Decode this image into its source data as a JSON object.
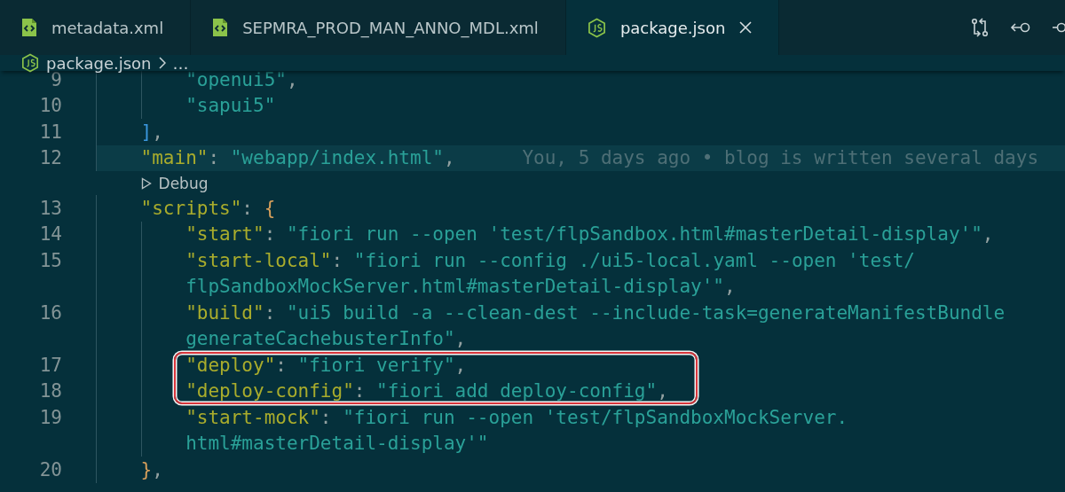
{
  "tabs": [
    {
      "label": "metadata.xml",
      "kind": "xml",
      "selected": false
    },
    {
      "label": "SEPMRA_PROD_MAN_ANNO_MDL.xml",
      "kind": "xml",
      "selected": false
    },
    {
      "label": "package.json",
      "kind": "json",
      "selected": true
    }
  ],
  "breadcrumb": {
    "file": "package.json",
    "more": "…"
  },
  "lines": [
    {
      "kind": "block",
      "children": [
        {
          "kind": "code",
          "number": "9",
          "current": false,
          "boxed": false,
          "tokens": [
            {
              "kind": "string",
              "text": "\"openui5\""
            },
            {
              "kind": "punct",
              "text": ","
            }
          ]
        },
        {
          "kind": "code",
          "number": "10",
          "current": false,
          "boxed": false,
          "tokens": [
            {
              "kind": "string",
              "text": "\"sapui5\""
            }
          ]
        }
      ]
    },
    {
      "kind": "code",
      "number": "11",
      "current": false,
      "boxed": false,
      "tokens": [
        {
          "kind": "bracket",
          "text": "]"
        },
        {
          "kind": "punct",
          "text": ","
        }
      ]
    },
    {
      "kind": "code",
      "number": "12",
      "current": true,
      "boxed": false,
      "blame": "You, 5 days ago • blog is written several days",
      "tokens": [
        {
          "kind": "key",
          "text": "\"main\""
        },
        {
          "kind": "punct",
          "text": ": "
        },
        {
          "kind": "string",
          "text": "\"webapp/index.html\""
        },
        {
          "kind": "punct",
          "text": ","
        }
      ]
    },
    {
      "kind": "codelens",
      "label": "Debug"
    },
    {
      "kind": "code",
      "number": "13",
      "current": false,
      "boxed": false,
      "tokens": [
        {
          "kind": "key",
          "text": "\"scripts\""
        },
        {
          "kind": "punct",
          "text": ": "
        },
        {
          "kind": "brace",
          "text": "{"
        }
      ]
    },
    {
      "kind": "block",
      "children": [
        {
          "kind": "code",
          "number": "14",
          "current": false,
          "boxed": false,
          "tokens": [
            {
              "kind": "key",
              "text": "\"start\""
            },
            {
              "kind": "punct",
              "text": ": "
            },
            {
              "kind": "string",
              "text": "\"fiori run --open 'test/flpSandbox.html#masterDetail-display'\""
            },
            {
              "kind": "punct",
              "text": ","
            }
          ]
        },
        {
          "kind": "code",
          "number": "15",
          "current": false,
          "boxed": false,
          "tokens": [
            {
              "kind": "key",
              "text": "\"start-local\""
            },
            {
              "kind": "punct",
              "text": ": "
            },
            {
              "kind": "string",
              "text": "\"fiori run --config ./ui5-local.yaml --open 'test/"
            }
          ]
        },
        {
          "kind": "code",
          "current": false,
          "boxed": false,
          "tokens": [
            {
              "kind": "string",
              "text": "flpSandboxMockServer.html#masterDetail-display'\""
            },
            {
              "kind": "punct",
              "text": ","
            }
          ]
        },
        {
          "kind": "code",
          "number": "16",
          "current": false,
          "boxed": false,
          "tokens": [
            {
              "kind": "key",
              "text": "\"build\""
            },
            {
              "kind": "punct",
              "text": ": "
            },
            {
              "kind": "string",
              "text": "\"ui5 build -a --clean-dest --include-task=generateManifestBundle"
            }
          ]
        },
        {
          "kind": "code",
          "current": false,
          "boxed": false,
          "tokens": [
            {
              "kind": "string",
              "text": "generateCachebusterInfo\""
            },
            {
              "kind": "punct",
              "text": ","
            }
          ]
        },
        {
          "kind": "code",
          "number": "17",
          "current": false,
          "boxed": true,
          "tokens": [
            {
              "kind": "key",
              "text": "\"deploy\""
            },
            {
              "kind": "punct",
              "text": ": "
            },
            {
              "kind": "string",
              "text": "\"fiori verify\""
            },
            {
              "kind": "punct",
              "text": ","
            }
          ]
        },
        {
          "kind": "code",
          "number": "18",
          "current": false,
          "boxed": true,
          "tokens": [
            {
              "kind": "key",
              "text": "\"deploy-config\""
            },
            {
              "kind": "punct",
              "text": ": "
            },
            {
              "kind": "string",
              "text": "\"fiori add deploy-config\""
            },
            {
              "kind": "punct",
              "text": ","
            }
          ]
        },
        {
          "kind": "code",
          "number": "19",
          "current": false,
          "boxed": false,
          "tokens": [
            {
              "kind": "key",
              "text": "\"start-mock\""
            },
            {
              "kind": "punct",
              "text": ": "
            },
            {
              "kind": "string",
              "text": "\"fiori run --open 'test/flpSandboxMockServer."
            }
          ]
        },
        {
          "kind": "code",
          "current": false,
          "boxed": false,
          "tokens": [
            {
              "kind": "string",
              "text": "html#masterDetail-display'\""
            }
          ]
        }
      ]
    },
    {
      "kind": "code",
      "number": "20",
      "current": false,
      "boxed": false,
      "tokens": [
        {
          "kind": "brace",
          "text": "}"
        },
        {
          "kind": "punct",
          "text": ","
        }
      ]
    }
  ]
}
